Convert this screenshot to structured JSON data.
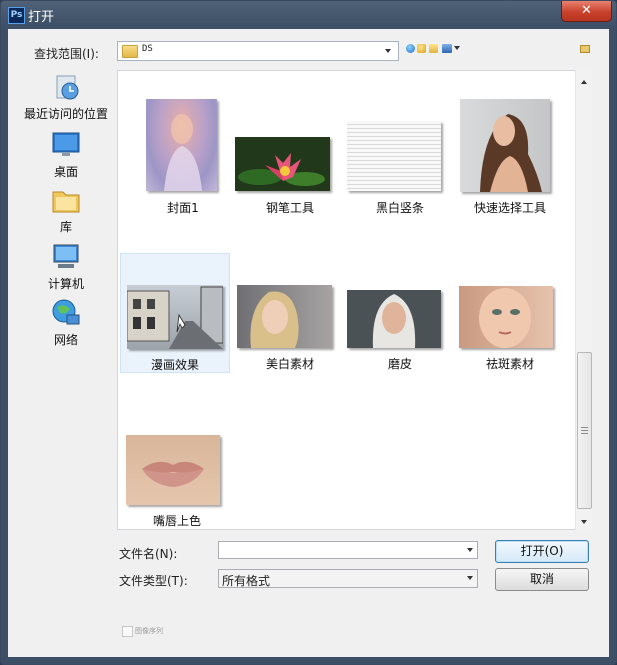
{
  "window": {
    "title": "打开",
    "app_icon": "Ps",
    "close_glyph": "✕"
  },
  "toolbar": {
    "look_in_label": "查找范围(I):",
    "look_in_value": "DS",
    "icons": [
      "back-icon",
      "up-folder-icon",
      "new-folder-icon",
      "view-menu-icon"
    ],
    "right_icon": "folder-icon"
  },
  "places": [
    {
      "label": "最近访问的位置",
      "icon": "recent-places-icon"
    },
    {
      "label": "桌面",
      "icon": "desktop-icon"
    },
    {
      "label": "库",
      "icon": "libraries-icon"
    },
    {
      "label": "计算机",
      "icon": "computer-icon"
    },
    {
      "label": "网络",
      "icon": "network-icon"
    }
  ],
  "files": [
    {
      "name": "封面1"
    },
    {
      "name": "钢笔工具"
    },
    {
      "name": "黑白竖条"
    },
    {
      "name": "快速选择工具"
    },
    {
      "name": "漫画效果"
    },
    {
      "name": "美白素材"
    },
    {
      "name": "磨皮"
    },
    {
      "name": "祛斑素材"
    },
    {
      "name": "嘴唇上色"
    }
  ],
  "selected_file": "漫画效果",
  "form": {
    "filename_label": "文件名(N):",
    "filename_value": "",
    "filetype_label": "文件类型(T):",
    "filetype_value": "所有格式",
    "open_button": "打开(O)",
    "cancel_button": "取消"
  },
  "image_sequence_label": "图像序列",
  "colors": {
    "title_bar": "#3d4f66",
    "close_button": "#c8412c",
    "selection": "#eaf3fc"
  }
}
